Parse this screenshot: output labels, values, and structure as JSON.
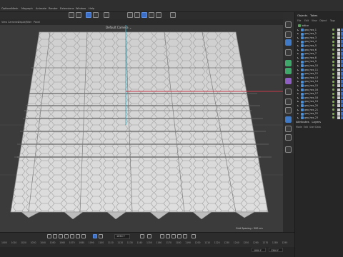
{
  "menu": [
    "Options",
    "Mesh",
    "Mograph",
    "Animate",
    "Render",
    "Extensions",
    "Window",
    "Help"
  ],
  "viewport_menu": [
    "View",
    "Cameras",
    "Display",
    "Filter",
    "Panel"
  ],
  "viewport": {
    "camera_label": "Default Camera ⌄",
    "status": "Grid Spacing : 500 cm"
  },
  "panel": {
    "tabs": [
      "Objects",
      "Takes"
    ],
    "menu": [
      "File",
      "Edit",
      "View",
      "Object",
      "Tags"
    ],
    "root": "lattice",
    "objects": [
      "geo_hex_1",
      "geo_hex_2",
      "geo_hex_3",
      "geo_hex_4",
      "geo_hex_5",
      "geo_hex_6",
      "geo_hex_7",
      "geo_hex_8",
      "geo_hex_9",
      "geo_hex_10",
      "geo_hex_11",
      "geo_hex_12",
      "geo_hex_13",
      "geo_hex_14",
      "geo_hex_15",
      "geo_hex_16",
      "geo_hex_17",
      "geo_hex_18",
      "geo_hex_19",
      "geo_hex_20",
      "geo_hex_21",
      "geo_hex_22",
      "geo_hex_23"
    ],
    "attr_tabs": [
      "Attributes",
      "Layers"
    ],
    "attr_menu": [
      "Mode",
      "Edit",
      "User Data"
    ]
  },
  "timeline": {
    "current_frame": "1050 F",
    "ticks": [
      "1000",
      "1010",
      "1020",
      "1030",
      "1040",
      "1050",
      "1060",
      "1070",
      "1080",
      "1090",
      "1100",
      "1110",
      "1120",
      "1130",
      "1140",
      "1150",
      "1160",
      "1170",
      "1180",
      "1190",
      "1200",
      "1210",
      "1220",
      "1230",
      "1240",
      "1250",
      "1260",
      "1270",
      "1280",
      "1290"
    ],
    "start_frame": "1000 F",
    "end_frame": "1300 F"
  },
  "colors": {
    "accent": "#3a6ec8",
    "axis_x": "#c8394a",
    "axis_y": "#39b4c8",
    "surface": "#d9d9d9"
  }
}
